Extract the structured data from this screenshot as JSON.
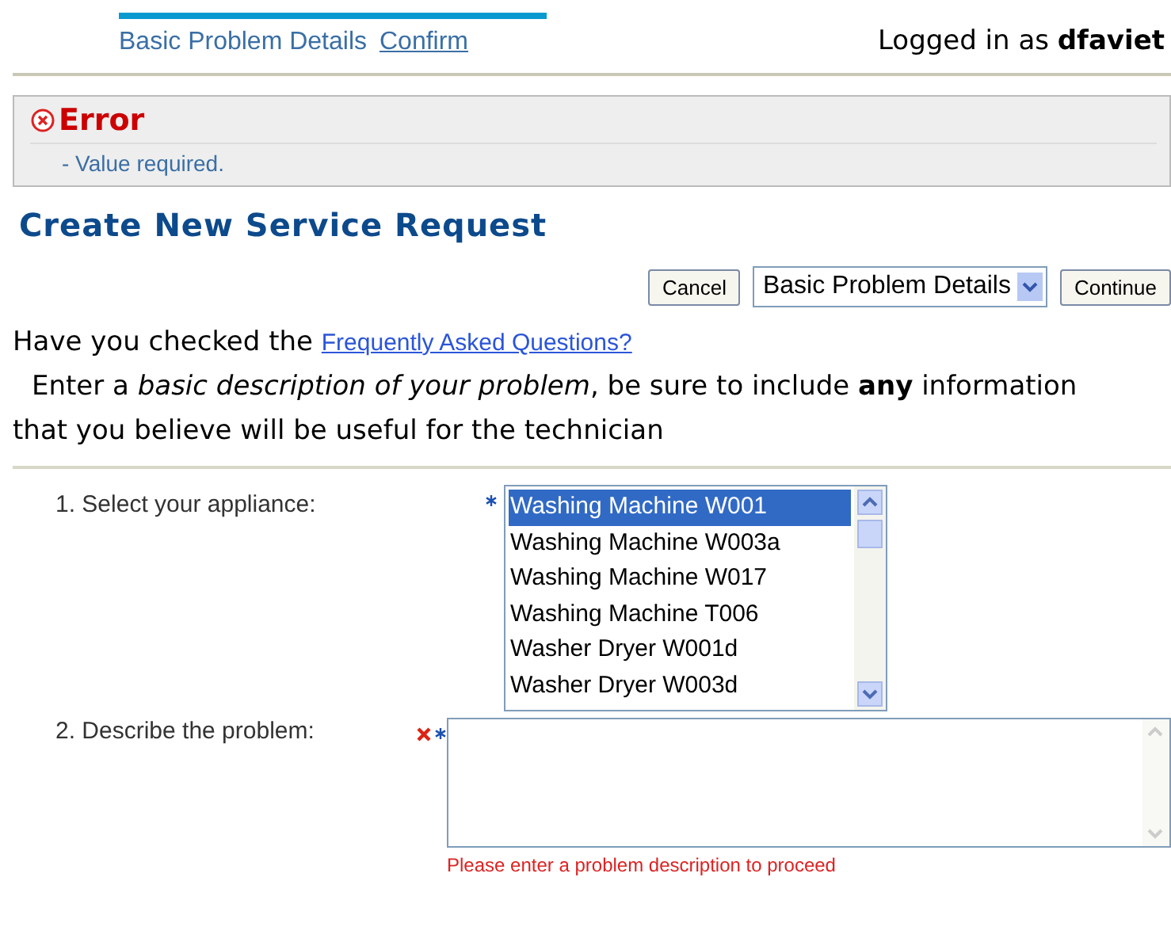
{
  "train": [
    {
      "label": "Basic Problem Details",
      "selected": true
    },
    {
      "label": "Confirm",
      "selected": false
    }
  ],
  "login": "Logged in as **dfaviet**",
  "error": {
    "title": "Error",
    "messages": [
      "- Value required."
    ]
  },
  "title": "Create New Service Request",
  "toolbar": {
    "cancel": "Cancel",
    "step": "Basic Problem Details",
    "continue": "Continue"
  },
  "intro": {
    "text": "Have you checked the",
    "link": "Frequently Asked Questions?"
  },
  "instructions": "Enter a *basic description of your problem*, be sure to include **any** information that you believe will be useful for the technician",
  "fields": [
    {
      "kind": "listbox",
      "label": "1. Select your appliance:",
      "required": true,
      "invalid": false,
      "options": [
        {
          "label": "Washing Machine W001",
          "selected": true
        },
        {
          "label": "Washing Machine W003a",
          "selected": false
        },
        {
          "label": "Washing Machine W017",
          "selected": false
        },
        {
          "label": "Washing Machine T006",
          "selected": false
        },
        {
          "label": "Washer Dryer W001d",
          "selected": false
        },
        {
          "label": "Washer Dryer W003d",
          "selected": false
        }
      ]
    },
    {
      "kind": "textarea",
      "label": "2. Describe the problem:",
      "required": true,
      "invalid": true,
      "message": "Please enter a problem description to proceed"
    }
  ]
}
